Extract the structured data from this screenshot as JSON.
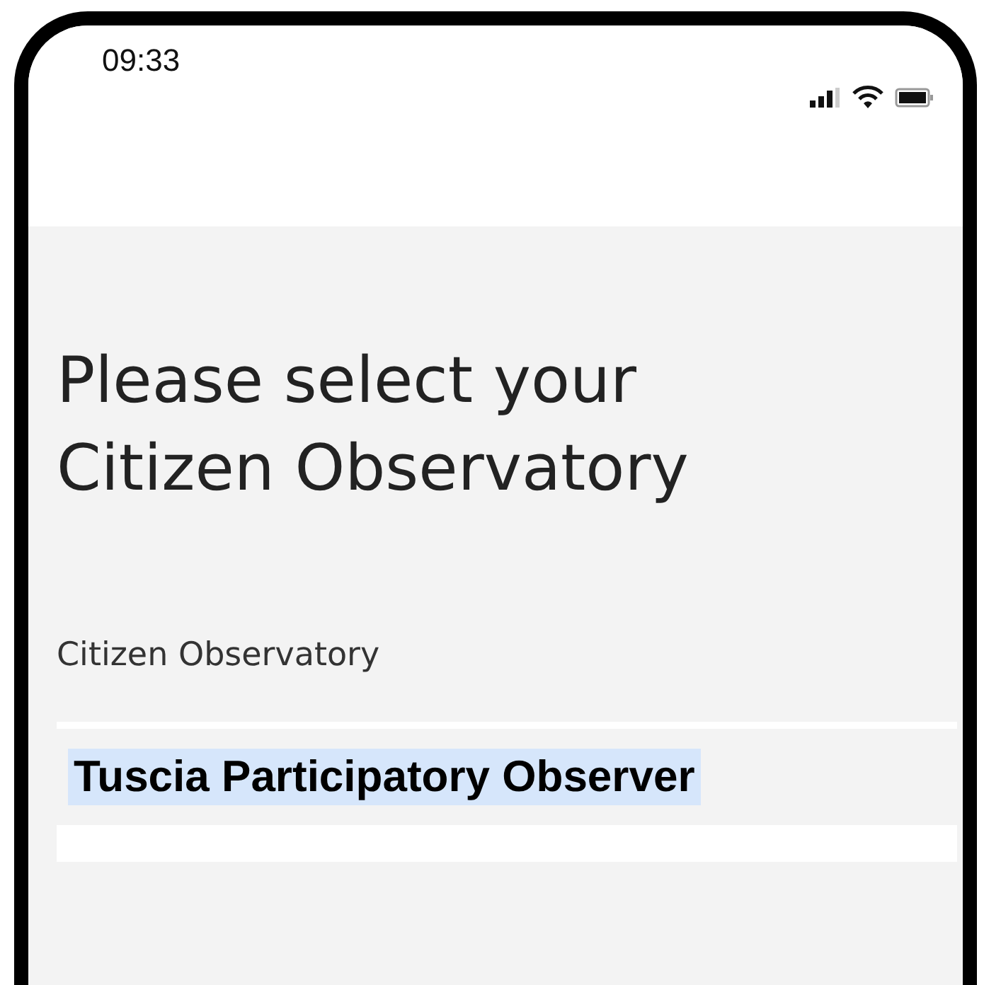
{
  "status_bar": {
    "time": "09:33"
  },
  "title": "Please select your Citizen Observatory",
  "field": {
    "label": "Citizen Observatory",
    "options": [
      {
        "label": "Tuscia Participatory Observer",
        "selected": true
      }
    ]
  }
}
